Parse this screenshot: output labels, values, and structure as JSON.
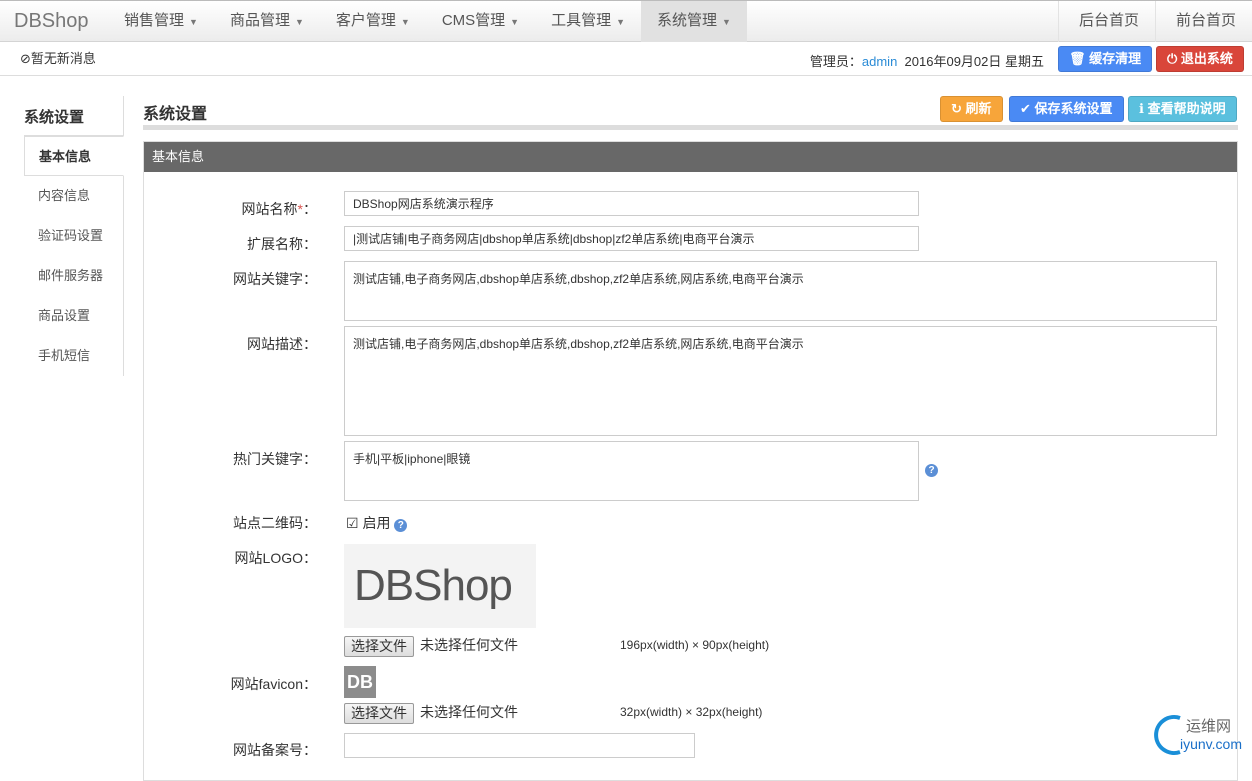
{
  "nav": {
    "brand": "DBShop",
    "menus": [
      "销售管理",
      "商品管理",
      "客户管理",
      "CMS管理",
      "工具管理",
      "系统管理"
    ],
    "active_menu": "系统管理",
    "right_links": [
      "后台首页",
      "前台首页"
    ]
  },
  "subbar": {
    "message": "暂无新消息",
    "admin_label": "管理员：",
    "admin_name": "admin",
    "date": "2016年09月02日 星期五",
    "clear_cache": "缓存清理",
    "logout": "退出系统"
  },
  "sidebar": {
    "title": "系统设置",
    "items": [
      "基本信息",
      "内容信息",
      "验证码设置",
      "邮件服务器",
      "商品设置",
      "手机短信"
    ],
    "active": "基本信息"
  },
  "page": {
    "title": "系统设置",
    "refresh": "刷新",
    "save": "保存系统设置",
    "help": "查看帮助说明",
    "panel_title": "基本信息"
  },
  "form": {
    "site_name_label": "网站名称",
    "site_name": "DBShop网店系统演示程序",
    "ext_name_label": "扩展名称：",
    "ext_name": "|测试店铺|电子商务网店|dbshop单店系统|dbshop|zf2单店系统|电商平台演示",
    "keywords_label": "网站关键字：",
    "keywords": "测试店铺,电子商务网店,dbshop单店系统,dbshop,zf2单店系统,网店系统,电商平台演示",
    "desc_label": "网站描述：",
    "desc": "测试店铺,电子商务网店,dbshop单店系统,dbshop,zf2单店系统,网店系统,电商平台演示",
    "hot_label": "热门关键字：",
    "hot": "手机|平板|iphone|眼镜",
    "qr_label": "站点二维码：",
    "qr_enable": "启用",
    "qr_checked": true,
    "logo_label": "网站LOGO：",
    "logo_text": "DBShop",
    "file_btn": "选择文件",
    "no_file": "未选择任何文件",
    "logo_dim": "196px(width) × 90px(height)",
    "favicon_label": "网站favicon：",
    "favicon_text": "DB",
    "favicon_dim": "32px(width) × 32px(height)",
    "icp_label": "网站备案号：",
    "icp": ""
  },
  "watermark": {
    "cn": "运维网",
    "url": "iyunv.com"
  },
  "colors": {
    "primary": "#4a8af4",
    "danger": "#d9463a",
    "warning": "#f7a53a",
    "info": "#5bc0de"
  }
}
